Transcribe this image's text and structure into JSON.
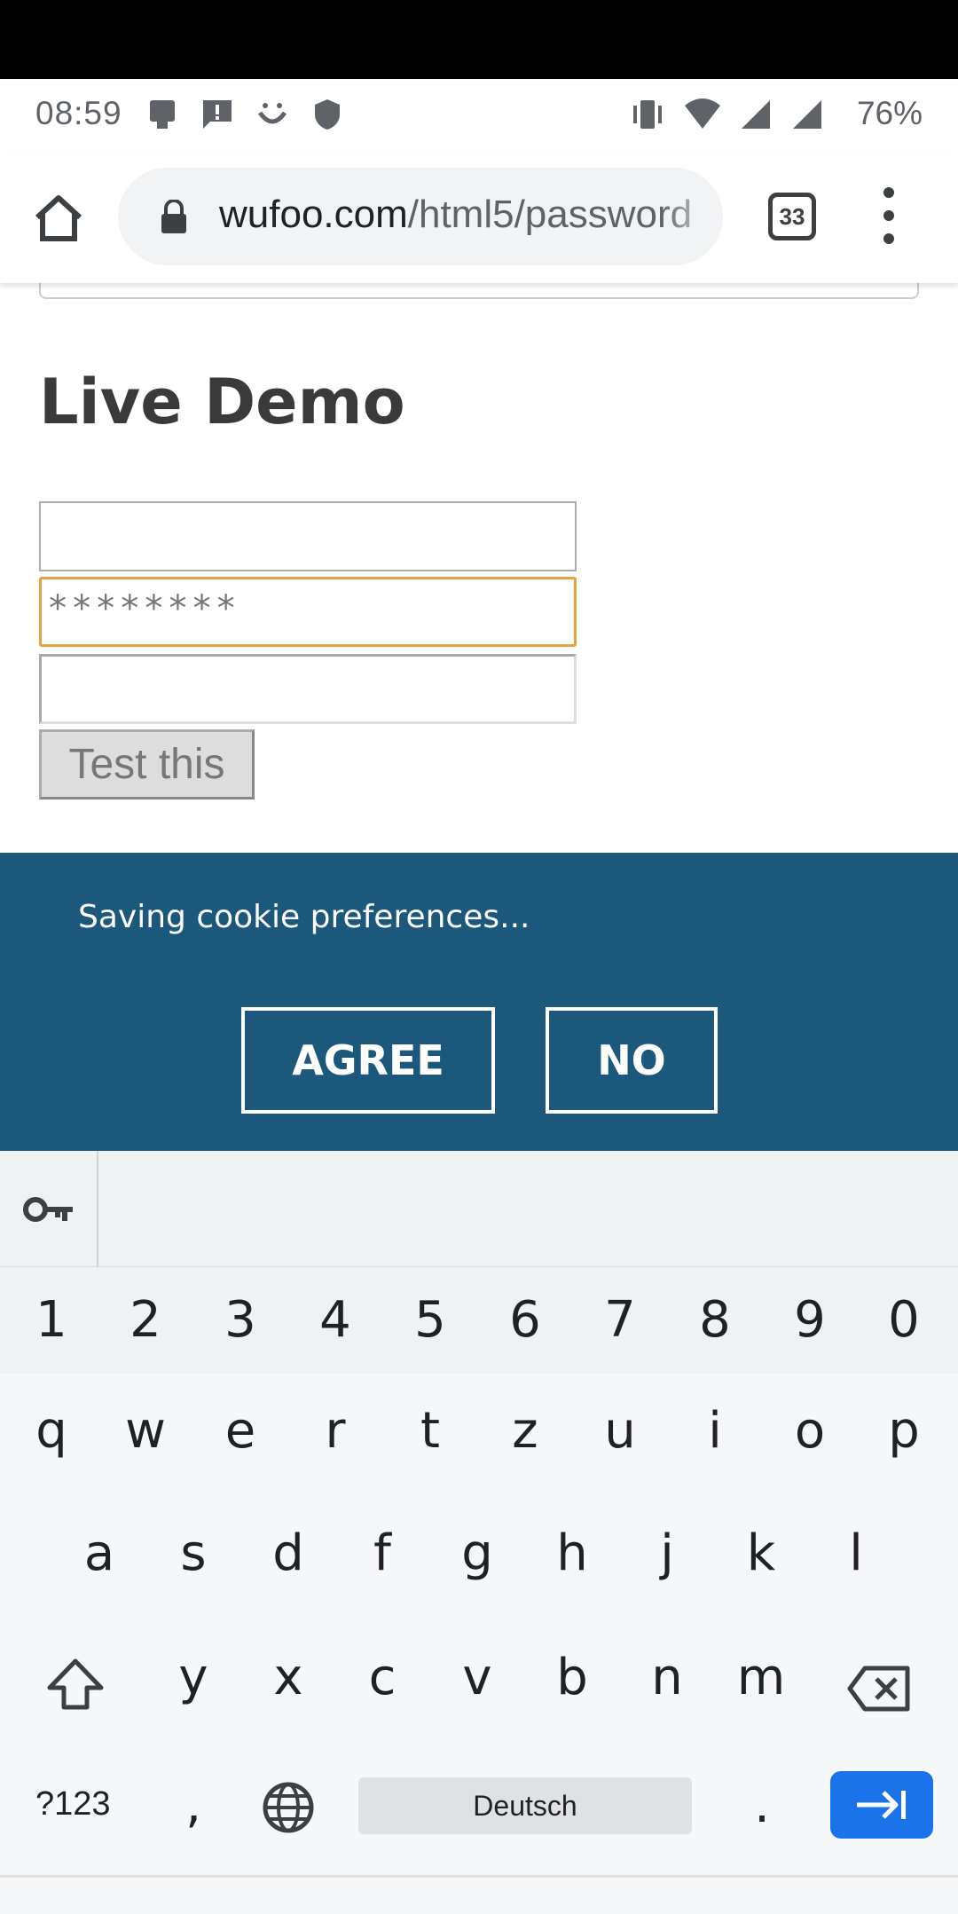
{
  "status_bar": {
    "time": "08:59",
    "battery": "76%"
  },
  "browser": {
    "url_host": "wufoo.com",
    "url_path": "/html5/password",
    "tab_count": "33"
  },
  "page": {
    "heading": "Live Demo",
    "password_value": "********",
    "test_button": "Test this"
  },
  "cookie_banner": {
    "text": "Saving cookie preferences...",
    "agree": "AGREE",
    "no": "NO"
  },
  "keyboard": {
    "numbers": [
      "1",
      "2",
      "3",
      "4",
      "5",
      "6",
      "7",
      "8",
      "9",
      "0"
    ],
    "row1": [
      "q",
      "w",
      "e",
      "r",
      "t",
      "z",
      "u",
      "i",
      "o",
      "p"
    ],
    "row2": [
      "a",
      "s",
      "d",
      "f",
      "g",
      "h",
      "j",
      "k",
      "l"
    ],
    "row3": [
      "y",
      "x",
      "c",
      "v",
      "b",
      "n",
      "m"
    ],
    "symbols_key": "?123",
    "comma": ",",
    "space_label": "Deutsch",
    "period": "."
  }
}
